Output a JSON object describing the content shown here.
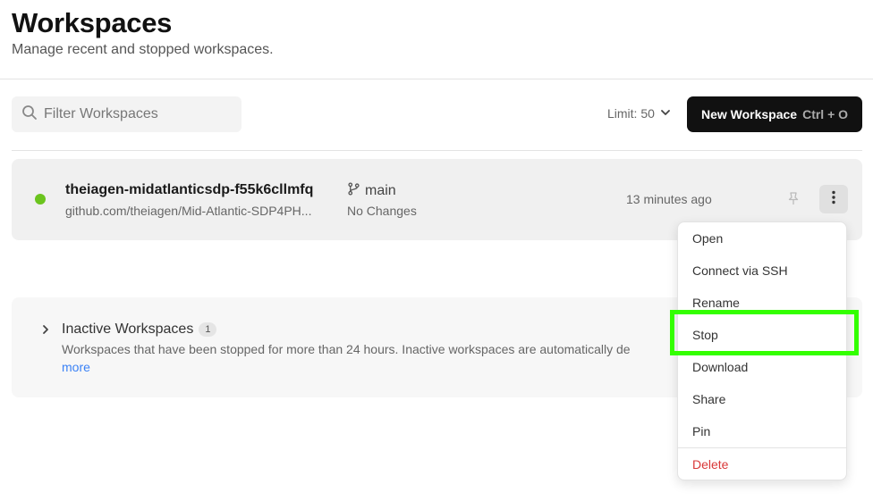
{
  "header": {
    "title": "Workspaces",
    "subtitle": "Manage recent and stopped workspaces."
  },
  "toolbar": {
    "search_placeholder": "Filter Workspaces",
    "limit_label": "Limit: 50",
    "new_button_label": "New Workspace",
    "new_button_shortcut": "Ctrl + O"
  },
  "workspace": {
    "name": "theiagen-midatlanticsdp-f55k6cllmfq",
    "repo": "github.com/theiagen/Mid-Atlantic-SDP4PH...",
    "branch": "main",
    "changes": "No Changes",
    "time": "13 minutes ago",
    "status_color": "#6bc41e"
  },
  "inactive": {
    "title": "Inactive Workspaces",
    "count": "1",
    "description": "Workspaces that have been stopped for more than 24 hours. Inactive workspaces are automatically de",
    "more_link": "more"
  },
  "menu": {
    "items": [
      "Open",
      "Connect via SSH",
      "Rename",
      "Stop",
      "Download",
      "Share",
      "Pin"
    ],
    "delete_label": "Delete"
  },
  "colors": {
    "accent_dark": "#111111",
    "danger": "#d93838",
    "link": "#3b82f6",
    "highlight": "#33ff00"
  }
}
